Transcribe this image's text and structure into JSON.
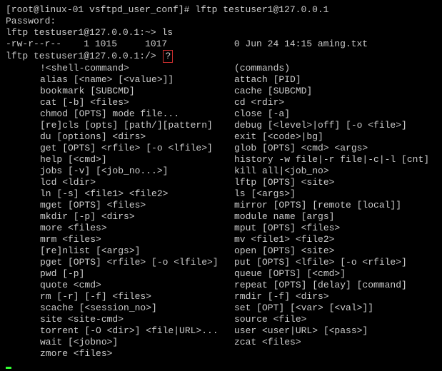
{
  "prompt1": "[root@linux-01 vsftpd_user_conf]# lftp testuser1@127.0.0.1",
  "password_label": "Password:",
  "prompt2_left": "lftp testuser1@127.0.0.1:~> ",
  "prompt2_cmd": "ls",
  "ls_line": "-rw-r--r--    1 1015     1017            0 Jun 24 14:15 aming.txt",
  "prompt3_left": "lftp testuser1@127.0.0.1:/> ",
  "prompt3_cmd": "?",
  "help": [
    {
      "l": "!<shell-command>",
      "r": "(commands)"
    },
    {
      "l": "alias [<name> [<value>]]",
      "r": "attach [PID]"
    },
    {
      "l": "bookmark [SUBCMD]",
      "r": "cache [SUBCMD]"
    },
    {
      "l": "cat [-b] <files>",
      "r": "cd <rdir>"
    },
    {
      "l": "chmod [OPTS] mode file...",
      "r": "close [-a]"
    },
    {
      "l": "[re]cls [opts] [path/][pattern]",
      "r": "debug [<level>|off] [-o <file>]"
    },
    {
      "l": "du [options] <dirs>",
      "r": "exit [<code>|bg]"
    },
    {
      "l": "get [OPTS] <rfile> [-o <lfile>]",
      "r": "glob [OPTS] <cmd> <args>"
    },
    {
      "l": "help [<cmd>]",
      "r": "history -w file|-r file|-c|-l [cnt]"
    },
    {
      "l": "jobs [-v] [<job_no...>]",
      "r": "kill all|<job_no>"
    },
    {
      "l": "lcd <ldir>",
      "r": "lftp [OPTS] <site>"
    },
    {
      "l": "ln [-s] <file1> <file2>",
      "r": "ls [<args>]"
    },
    {
      "l": "mget [OPTS] <files>",
      "r": "mirror [OPTS] [remote [local]]"
    },
    {
      "l": "mkdir [-p] <dirs>",
      "r": "module name [args]"
    },
    {
      "l": "more <files>",
      "r": "mput [OPTS] <files>"
    },
    {
      "l": "mrm <files>",
      "r": "mv <file1> <file2>"
    },
    {
      "l": "[re]nlist [<args>]",
      "r": "open [OPTS] <site>"
    },
    {
      "l": "pget [OPTS] <rfile> [-o <lfile>]",
      "r": "put [OPTS] <lfile> [-o <rfile>]"
    },
    {
      "l": "pwd [-p]",
      "r": "queue [OPTS] [<cmd>]"
    },
    {
      "l": "quote <cmd>",
      "r": "repeat [OPTS] [delay] [command]"
    },
    {
      "l": "rm [-r] [-f] <files>",
      "r": "rmdir [-f] <dirs>"
    },
    {
      "l": "scache [<session_no>]",
      "r": "set [OPT] [<var> [<val>]]"
    },
    {
      "l": "site <site-cmd>",
      "r": "source <file>"
    },
    {
      "l": "torrent [-O <dir>] <file|URL>...",
      "r": "user <user|URL> [<pass>]"
    },
    {
      "l": "wait [<jobno>]",
      "r": "zcat <files>"
    },
    {
      "l": "zmore <files>",
      "r": ""
    }
  ]
}
